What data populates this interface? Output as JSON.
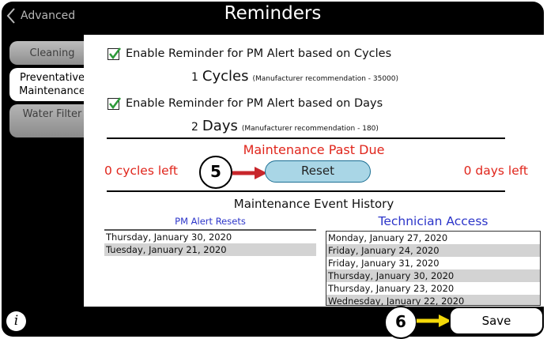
{
  "header": {
    "back_label": "Advanced",
    "title": "Reminders"
  },
  "sidebar": {
    "tabs": [
      {
        "label": "Cleaning",
        "selected": false
      },
      {
        "label": "Preventative Maintenance",
        "selected": true
      },
      {
        "label": "Water Filter",
        "selected": false
      }
    ]
  },
  "reminders": {
    "cycles": {
      "checked": true,
      "label": "Enable Reminder for PM Alert based on Cycles",
      "value": "1",
      "unit": "Cycles",
      "note": "(Manufacturer recommendation - 35000)"
    },
    "days": {
      "checked": true,
      "label": "Enable Reminder for PM Alert based on Days",
      "value": "2",
      "unit": "Days",
      "note": "(Manufacturer recommendation - 180)"
    }
  },
  "status": {
    "title": "Maintenance Past Due",
    "cycles_left": "0 cycles left",
    "days_left": "0 days left",
    "reset_label": "Reset",
    "color": "#e0251b"
  },
  "history": {
    "title": "Maintenance Event History",
    "pm_header": "PM Alert Resets",
    "tech_header": "Technician Access",
    "pm_resets": [
      "Thursday, January 30, 2020",
      "Tuesday, January 21, 2020"
    ],
    "technician_access": [
      "Monday, January 27, 2020",
      "Friday, January 24, 2020",
      "Friday, January 31, 2020",
      "Thursday, January 30, 2020",
      "Thursday, January 23, 2020",
      "Wednesday, January 22, 2020"
    ]
  },
  "footer": {
    "info_label": "i",
    "save_label": "Save"
  },
  "callouts": {
    "step_reset": "5",
    "step_save": "6",
    "arrow_reset_color": "#c8262b",
    "arrow_save_color": "#f4d90a"
  }
}
